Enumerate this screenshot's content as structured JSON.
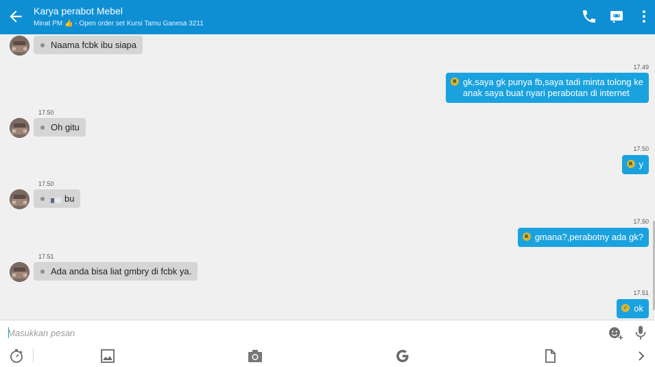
{
  "header": {
    "title": "Karya perabot Mebel",
    "subtitle": "Minat PM 👍 - Open order set Kursi Tamu Ganesa 3211",
    "icons": [
      "back-arrow-icon",
      "phone-icon",
      "video-call-icon",
      "more-vert-icon"
    ]
  },
  "messages": [
    {
      "side": "in",
      "time": "",
      "text": "Naama fcbk ibu siapa"
    },
    {
      "side": "out",
      "time": "17.49",
      "badge": "R",
      "text_line1": "gk,saya gk punya fb,saya tadi minta tolong ke",
      "text_line2": "anak saya buat nyari perabotan di internet"
    },
    {
      "side": "in",
      "time": "17.50",
      "text": "Oh gitu"
    },
    {
      "side": "out",
      "time": "17.50",
      "badge": "R",
      "text": "y"
    },
    {
      "side": "in",
      "time": "17.50",
      "text": "bu"
    },
    {
      "side": "out",
      "time": "17.50",
      "badge": "R",
      "text": "gmana?,perabotny ada gk?"
    },
    {
      "side": "in",
      "time": "17.51",
      "text": "Ada anda bisa liat gmbry di fcbk ya."
    },
    {
      "side": "out",
      "time": "17.51",
      "badge": "✓",
      "text": "ok"
    }
  ],
  "input": {
    "placeholder": "Masukkan pesan"
  },
  "toolbar": {
    "icons": [
      "timer-icon",
      "image-icon",
      "camera-icon",
      "google-icon",
      "file-icon",
      "chevron-right-icon",
      "emoji-add-icon",
      "microphone-icon"
    ]
  },
  "colors": {
    "header": "#0e8fd4",
    "outgoing_bubble": "#1aa2df",
    "incoming_bubble": "#d5d5d5",
    "background": "#f0f0f0"
  }
}
